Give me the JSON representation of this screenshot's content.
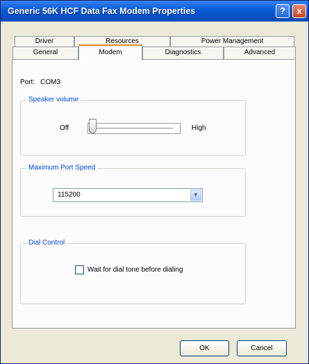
{
  "window": {
    "title": "Generic 56K HCF Data Fax Modem Properties",
    "help_glyph": "?",
    "close_glyph": "x"
  },
  "tabs": {
    "row1": [
      "Driver",
      "Resources",
      "Power Management"
    ],
    "row2": [
      "General",
      "Modem",
      "Diagnostics",
      "Advanced"
    ],
    "active": "Modem"
  },
  "port": {
    "label": "Port:",
    "value": "COM3"
  },
  "speaker_volume": {
    "label": "Speaker volume",
    "min_label": "Off",
    "max_label": "High",
    "level": 0
  },
  "max_port_speed": {
    "label": "Maximum Port Speed",
    "value": "115200"
  },
  "dial_control": {
    "label": "Dial Control",
    "wait_label": "Wait for dial tone before dialing",
    "wait_checked": false
  },
  "buttons": {
    "ok": "OK",
    "cancel": "Cancel"
  },
  "colors": {
    "titlebar": "#0a5fd8",
    "group_label": "#0046d5",
    "active_tab_accent": "#e68b2c"
  }
}
